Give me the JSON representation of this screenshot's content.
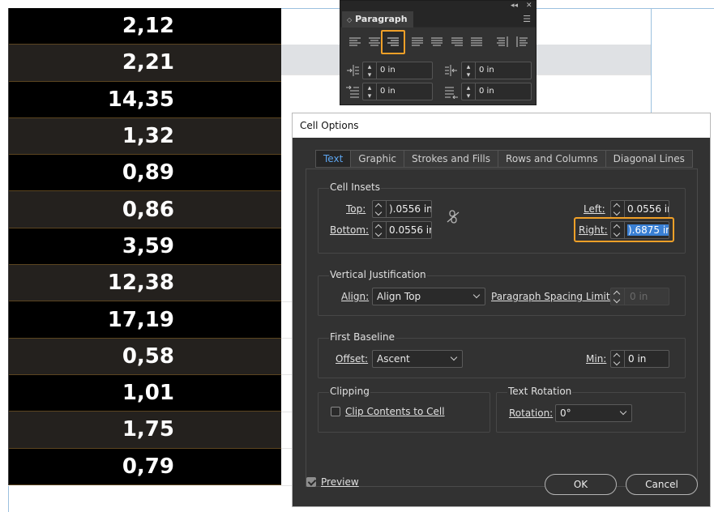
{
  "table": {
    "values": [
      "2,12",
      "2,21",
      "14,35",
      "1,32",
      "0,89",
      "0,86",
      "3,59",
      "12,38",
      "17,19",
      "0,58",
      "1,01",
      "1,75",
      "0,79"
    ]
  },
  "paragraph_panel": {
    "title": "Paragraph",
    "left_indent": "0 in",
    "right_indent": "0 in",
    "first_line_indent": "0 in",
    "last_line_indent": "0 in"
  },
  "cell_options": {
    "title": "Cell Options",
    "tabs": [
      "Text",
      "Graphic",
      "Strokes and Fills",
      "Rows and Columns",
      "Diagonal Lines"
    ],
    "active_tab": "Text",
    "cell_insets": {
      "heading": "Cell Insets",
      "top_label": "Top:",
      "top_value": ").0556 in",
      "bottom_label": "Bottom:",
      "bottom_value": "0.0556 ir",
      "left_label": "Left:",
      "left_value": "0.0556 ir",
      "right_label": "Right:",
      "right_value": ").6875 in"
    },
    "vertical_justification": {
      "heading": "Vertical Justification",
      "align_label": "Align:",
      "align_value": "Align Top",
      "spacing_label": "Paragraph Spacing Limit:",
      "spacing_value": "0 in"
    },
    "first_baseline": {
      "heading": "First Baseline",
      "offset_label": "Offset:",
      "offset_value": "Ascent",
      "min_label": "Min:",
      "min_value": "0 in"
    },
    "clipping": {
      "heading": "Clipping",
      "clip_label": "Clip Contents to Cell",
      "clip_checked": false
    },
    "text_rotation": {
      "heading": "Text Rotation",
      "rotation_label": "Rotation:",
      "rotation_value": "0°"
    },
    "preview_label": "Preview",
    "preview_checked": true,
    "ok_label": "OK",
    "cancel_label": "Cancel"
  },
  "colors": {
    "highlight": "#f0a028",
    "selection": "#3a80d4",
    "active_tab_text": "#5da5ef",
    "dialog_bg": "#323232"
  }
}
